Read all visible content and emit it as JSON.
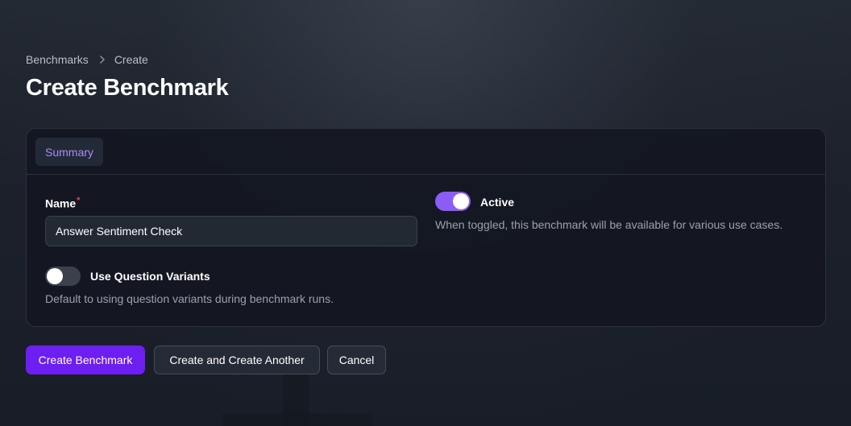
{
  "breadcrumb": {
    "items": [
      "Benchmarks",
      "Create"
    ]
  },
  "page": {
    "title": "Create Benchmark"
  },
  "tabs": [
    {
      "label": "Summary",
      "active": true
    }
  ],
  "form": {
    "name": {
      "label": "Name",
      "required_mark": "*",
      "value": "Answer Sentiment Check"
    },
    "active": {
      "label": "Active",
      "checked": true,
      "helper": "When toggled, this benchmark will be available for various use cases."
    },
    "question_variants": {
      "label": "Use Question Variants",
      "checked": false,
      "helper": "Default to using question variants during benchmark runs."
    }
  },
  "actions": {
    "create_label": "Create Benchmark",
    "create_another_label": "Create and Create Another",
    "cancel_label": "Cancel"
  },
  "icons": {
    "breadcrumb_separator": "chevron-right-icon"
  },
  "colors": {
    "accent": "#8b5cf6",
    "primary_button": "#6d1ef0",
    "tab_text": "#a78bfa",
    "required": "#ef4444"
  }
}
